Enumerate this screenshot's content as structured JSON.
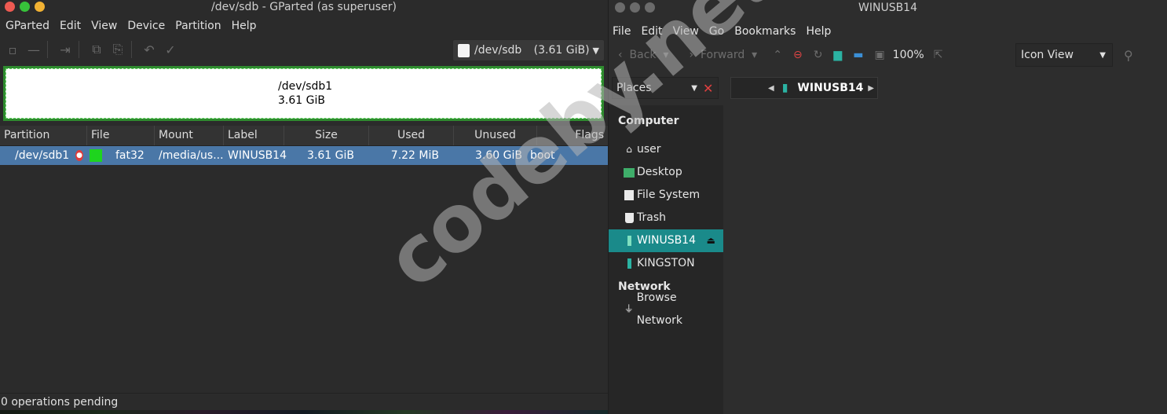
{
  "gparted": {
    "title": "/dev/sdb - GParted (as superuser)",
    "menu": [
      "GParted",
      "Edit",
      "View",
      "Device",
      "Partition",
      "Help"
    ],
    "device_select": {
      "device": "/dev/sdb",
      "size": "(3.61 GiB)"
    },
    "partition_bar": {
      "name": "/dev/sdb1",
      "size": "3.61 GiB"
    },
    "columns": [
      "Partition",
      "File System",
      "Mount Point",
      "Label",
      "Size",
      "Used",
      "Unused",
      "Flags"
    ],
    "rows": [
      {
        "partition": "/dev/sdb1",
        "filesystem": "fat32",
        "mount": "/media/us...",
        "label": "WINUSB14",
        "size": "3.61 GiB",
        "used": "7.22 MiB",
        "unused": "3.60 GiB",
        "flags": "boot"
      }
    ],
    "status": "0 operations pending",
    "colors": {
      "selected_row": "#4a77a7",
      "fat32": "#1ed41e",
      "partition_border": "#2f8b2f"
    }
  },
  "caja": {
    "title": "WINUSB14",
    "menu": [
      "File",
      "Edit",
      "View",
      "Go",
      "Bookmarks",
      "Help"
    ],
    "toolbar": {
      "back": "Back",
      "forward": "Forward",
      "zoom": "100%",
      "view_mode": "Icon View"
    },
    "places_label": "Places",
    "breadcrumb": "WINUSB14",
    "sidebar": {
      "computer_head": "Computer",
      "items": [
        {
          "label": "user",
          "icon": "home-icon"
        },
        {
          "label": "Desktop",
          "icon": "desktop-folder-icon"
        },
        {
          "label": "File System",
          "icon": "drive-icon"
        },
        {
          "label": "Trash",
          "icon": "trash-icon"
        },
        {
          "label": "WINUSB14",
          "icon": "usb-icon",
          "active": true
        },
        {
          "label": "KINGSTON",
          "icon": "usb-icon"
        }
      ],
      "network_head": "Network",
      "network_items": [
        {
          "label": "Browse Network",
          "icon": "network-icon"
        }
      ]
    },
    "colors": {
      "active_item": "#1a8a8a"
    }
  },
  "watermark": "codeby.net"
}
